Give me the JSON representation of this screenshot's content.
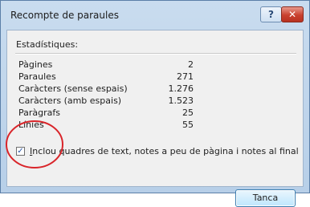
{
  "window": {
    "title": "Recompte de paraules",
    "help_label": "?",
    "close_label": "✕"
  },
  "stats": {
    "group_label": "Estadístiques:",
    "rows": [
      {
        "label": "Pàgines",
        "value": "2"
      },
      {
        "label": "Paraules",
        "value": "271"
      },
      {
        "label": "Caràcters (sense espais)",
        "value": "1.276"
      },
      {
        "label": "Caràcters (amb espais)",
        "value": "1.523"
      },
      {
        "label": "Paràgrafs",
        "value": "25"
      },
      {
        "label": "Línies",
        "value": "55"
      }
    ]
  },
  "option": {
    "checked": true,
    "check_glyph": "✓",
    "label": "Inclou quadres de text, notes a peu de pàgina i notes al final"
  },
  "buttons": {
    "close_label": "Tanca"
  },
  "colors": {
    "annotation": "#d9252a",
    "accent": "#3c7fb1"
  }
}
